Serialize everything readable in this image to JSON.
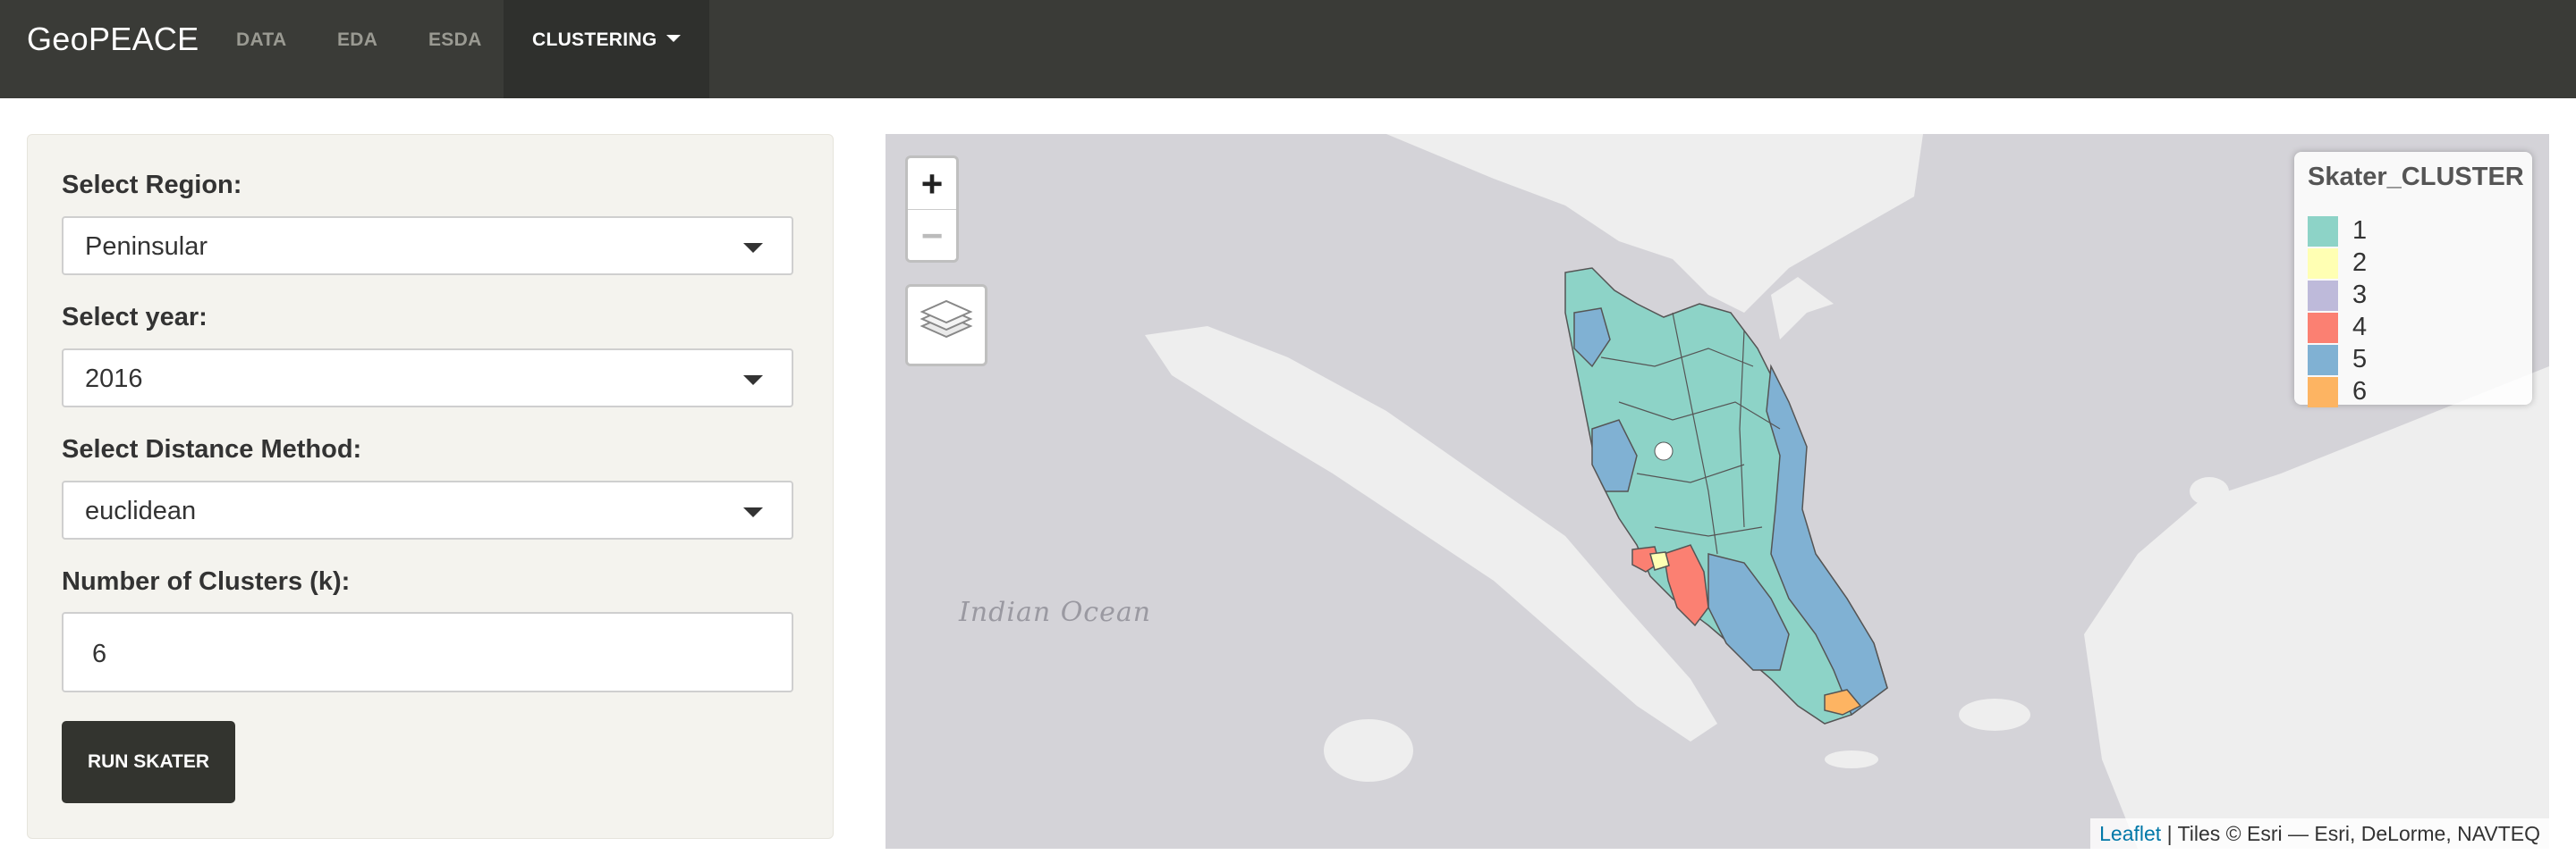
{
  "navbar": {
    "brand": "GeoPEACE",
    "items": [
      {
        "label": "DATA"
      },
      {
        "label": "EDA"
      },
      {
        "label": "ESDA"
      },
      {
        "label": "CLUSTERING"
      }
    ]
  },
  "sidebar": {
    "region": {
      "label": "Select Region:",
      "value": "Peninsular"
    },
    "year": {
      "label": "Select year:",
      "value": "2016"
    },
    "distance": {
      "label": "Select Distance Method:",
      "value": "euclidean"
    },
    "clusters": {
      "label": "Number of Clusters (k):",
      "value": "6"
    },
    "run_button": "RUN SKATER"
  },
  "map": {
    "zoom_in": "+",
    "zoom_out": "−",
    "ocean_label": "Indian Ocean",
    "legend": {
      "title": "Skater_CLUSTER",
      "items": [
        {
          "label": "1",
          "color": "#8dd3c7"
        },
        {
          "label": "2",
          "color": "#ffffb3"
        },
        {
          "label": "3",
          "color": "#bebada"
        },
        {
          "label": "4",
          "color": "#fb8072"
        },
        {
          "label": "5",
          "color": "#80b1d3"
        },
        {
          "label": "6",
          "color": "#fdb462"
        }
      ]
    },
    "attribution_link": "Leaflet",
    "attribution_text": " | Tiles © Esri — Esri, DeLorme, NAVTEQ"
  }
}
